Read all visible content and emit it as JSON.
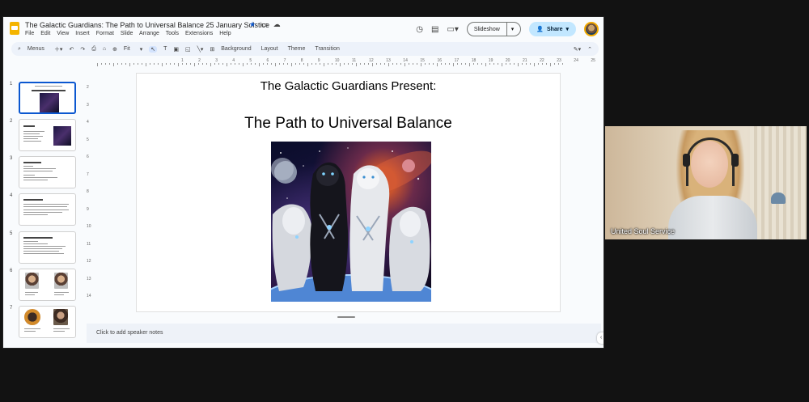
{
  "header": {
    "doc_title": "The Galactic Guardians: The Path to Universal Balance 25 January Solstice",
    "star_icon": "★",
    "menu": [
      "File",
      "Edit",
      "View",
      "Insert",
      "Format",
      "Slide",
      "Arrange",
      "Tools",
      "Extensions",
      "Help"
    ],
    "slideshow_label": "Slideshow",
    "share_label": "Share"
  },
  "toolbar": {
    "menus_label": "Menus",
    "zoom_label": "Fit",
    "background_label": "Background",
    "layout_label": "Layout",
    "theme_label": "Theme",
    "transition_label": "Transition"
  },
  "ruler": {
    "h_labels": [
      "1",
      "2",
      "3",
      "4",
      "5",
      "6",
      "7",
      "8",
      "9",
      "10",
      "11",
      "12",
      "13",
      "14",
      "15",
      "16",
      "17",
      "18",
      "19",
      "20",
      "21",
      "22",
      "23",
      "24",
      "25"
    ],
    "v_labels": [
      "2",
      "3",
      "4",
      "5",
      "6",
      "7",
      "8",
      "9",
      "10",
      "11",
      "12",
      "13",
      "14"
    ]
  },
  "filmstrip": {
    "numbers": [
      "1",
      "2",
      "3",
      "4",
      "5",
      "6",
      "7"
    ]
  },
  "slide": {
    "pre_title": "The Galactic Guardians Present:",
    "title": "The Path to Universal Balance"
  },
  "notes": {
    "placeholder": "Click to add speaker notes"
  },
  "video": {
    "participant_name": "United Soul Service"
  },
  "colors": {
    "accent": "#0b57d0",
    "share_button": "#c2e7ff",
    "slides_logo": "#f4b400"
  }
}
